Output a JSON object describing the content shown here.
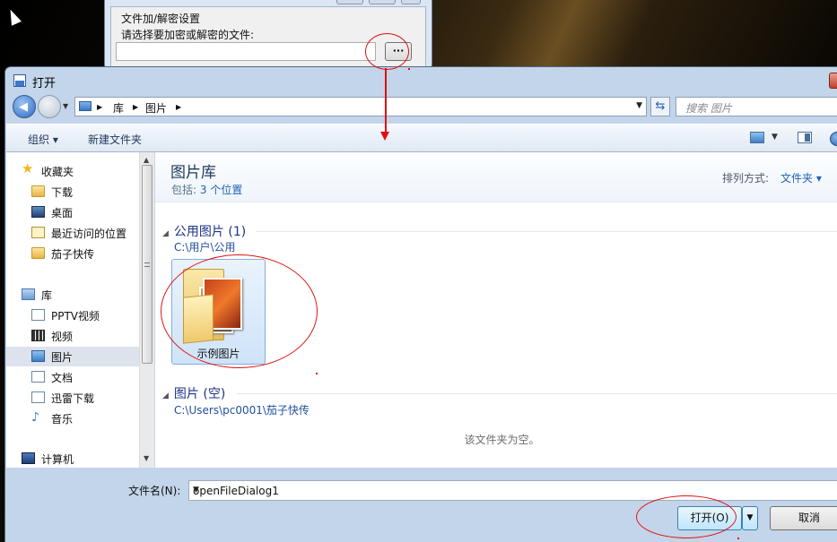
{
  "background_window": {
    "group_label": "文件加/解密设置",
    "prompt": "请选择要加密或解密的文件:",
    "browse_label": "···"
  },
  "dialog": {
    "title": "打开",
    "address": {
      "crumbs": [
        "库",
        "图片"
      ],
      "search_placeholder": "搜索 图片"
    },
    "toolbar": {
      "organize": "组织 ▾",
      "new_folder": "新建文件夹"
    },
    "nav": {
      "items": [
        {
          "label": "收藏夹",
          "icon": "star-icon"
        },
        {
          "label": "下载",
          "icon": "folder-icon"
        },
        {
          "label": "桌面",
          "icon": "desktop-icon"
        },
        {
          "label": "最近访问的位置",
          "icon": "recent-places-icon"
        },
        {
          "label": "茄子快传",
          "icon": "folder-icon"
        },
        {
          "label": "库",
          "icon": "library-icon"
        },
        {
          "label": "PPTV视频",
          "icon": "library-document-icon"
        },
        {
          "label": "视频",
          "icon": "video-icon"
        },
        {
          "label": "图片",
          "icon": "picture-icon"
        },
        {
          "label": "文档",
          "icon": "document-icon"
        },
        {
          "label": "迅雷下载",
          "icon": "library-document-icon"
        },
        {
          "label": "音乐",
          "icon": "music-icon"
        },
        {
          "label": "计算机",
          "icon": "computer-icon"
        }
      ]
    },
    "content": {
      "library_title": "图片库",
      "includes_prefix": "包括:",
      "includes_value": "3 个位置",
      "arrange_label": "排列方式:",
      "arrange_value": "文件夹 ▾",
      "groups": [
        {
          "title": "公用图片 (1)",
          "path": "C:\\用户\\公用",
          "items": [
            "示例图片"
          ]
        },
        {
          "title": "图片 (空)",
          "path": "C:\\Users\\pc0001\\茄子快传",
          "empty_text": "该文件夹为空。"
        }
      ]
    },
    "footer": {
      "filename_label": "文件名(N):",
      "filename_value": "openFileDialog1",
      "open_button": "打开(O)",
      "cancel_button": "取消"
    }
  },
  "colors": {
    "annotation": "#e11010",
    "link": "#1f62b4"
  }
}
